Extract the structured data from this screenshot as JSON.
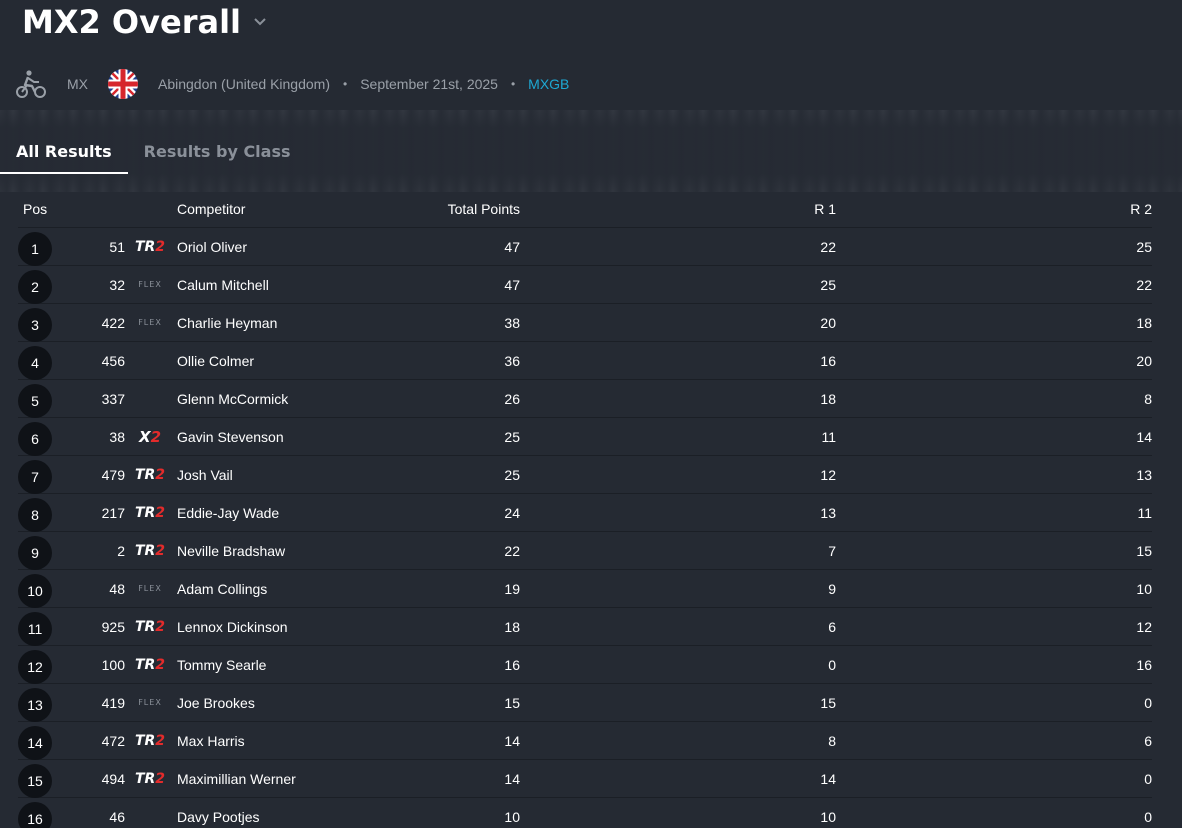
{
  "header": {
    "title": "MX2 Overall",
    "sport": "MX",
    "venue": "Abingdon (United Kingdom)",
    "date": "September 21st, 2025",
    "series_link": "MXGB",
    "bullet": "•"
  },
  "tabs": [
    {
      "label": "All Results",
      "active": true
    },
    {
      "label": "Results by Class",
      "active": false
    }
  ],
  "table": {
    "headers": {
      "pos": "Pos",
      "competitor": "Competitor",
      "total": "Total Points",
      "r1": "R 1",
      "r2": "R 2"
    },
    "rows": [
      {
        "pos": "1",
        "num": "51",
        "brand": "TR2",
        "name": "Oriol Oliver",
        "total": "47",
        "r1": "22",
        "r2": "25"
      },
      {
        "pos": "2",
        "num": "32",
        "brand": "FLEX",
        "name": "Calum Mitchell",
        "total": "47",
        "r1": "25",
        "r2": "22"
      },
      {
        "pos": "3",
        "num": "422",
        "brand": "FLEX",
        "name": "Charlie Heyman",
        "total": "38",
        "r1": "20",
        "r2": "18"
      },
      {
        "pos": "4",
        "num": "456",
        "brand": "",
        "name": "Ollie Colmer",
        "total": "36",
        "r1": "16",
        "r2": "20"
      },
      {
        "pos": "5",
        "num": "337",
        "brand": "",
        "name": "Glenn McCormick",
        "total": "26",
        "r1": "18",
        "r2": "8"
      },
      {
        "pos": "6",
        "num": "38",
        "brand": "X2",
        "name": "Gavin Stevenson",
        "total": "25",
        "r1": "11",
        "r2": "14"
      },
      {
        "pos": "7",
        "num": "479",
        "brand": "TR2",
        "name": "Josh Vail",
        "total": "25",
        "r1": "12",
        "r2": "13"
      },
      {
        "pos": "8",
        "num": "217",
        "brand": "TR2",
        "name": "Eddie-Jay Wade",
        "total": "24",
        "r1": "13",
        "r2": "11"
      },
      {
        "pos": "9",
        "num": "2",
        "brand": "TR2",
        "name": "Neville Bradshaw",
        "total": "22",
        "r1": "7",
        "r2": "15"
      },
      {
        "pos": "10",
        "num": "48",
        "brand": "FLEX",
        "name": "Adam Collings",
        "total": "19",
        "r1": "9",
        "r2": "10"
      },
      {
        "pos": "11",
        "num": "925",
        "brand": "TR2",
        "name": "Lennox Dickinson",
        "total": "18",
        "r1": "6",
        "r2": "12"
      },
      {
        "pos": "12",
        "num": "100",
        "brand": "TR2",
        "name": "Tommy Searle",
        "total": "16",
        "r1": "0",
        "r2": "16"
      },
      {
        "pos": "13",
        "num": "419",
        "brand": "FLEX",
        "name": "Joe Brookes",
        "total": "15",
        "r1": "15",
        "r2": "0"
      },
      {
        "pos": "14",
        "num": "472",
        "brand": "TR2",
        "name": "Max Harris",
        "total": "14",
        "r1": "8",
        "r2": "6"
      },
      {
        "pos": "15",
        "num": "494",
        "brand": "TR2",
        "name": "Maximillian Werner",
        "total": "14",
        "r1": "14",
        "r2": "0"
      },
      {
        "pos": "16",
        "num": "46",
        "brand": "",
        "name": "Davy Pootjes",
        "total": "10",
        "r1": "10",
        "r2": "0"
      }
    ]
  },
  "icons": {
    "sport": "motorbike-icon",
    "flag": "united-kingdom-flag-icon",
    "dropdown": "chevron-down-icon"
  },
  "colors": {
    "background": "#252a33",
    "accent_link": "#1ea8d3",
    "brand_red": "#e32b2b",
    "pos_circle": "#0f1217"
  }
}
